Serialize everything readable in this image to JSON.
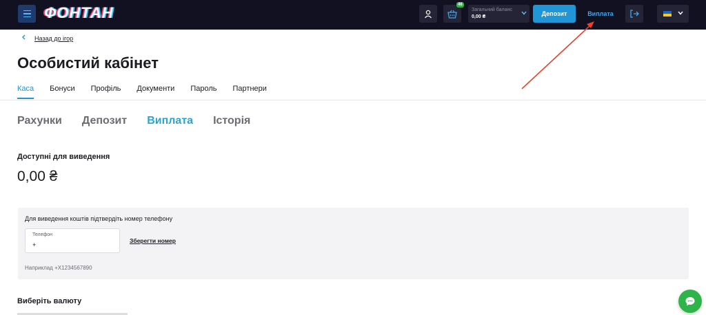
{
  "header": {
    "logo_text": "ФОНТАН",
    "cart_badge": "46",
    "balance_label": "Загальний баланс",
    "balance_value": "0,00 ₴",
    "deposit_label": "Депозит",
    "payout_label": "Виплата",
    "language_flag": "Ukraine",
    "icons": [
      "menu-icon",
      "user-icon",
      "basket-icon",
      "chevron-down-icon",
      "logout-icon",
      "flag-icon"
    ]
  },
  "back_link": "Назад до ігор",
  "page_title": "Особистий кабінет",
  "tabs": [
    {
      "label": "Каса"
    },
    {
      "label": "Бонуси"
    },
    {
      "label": "Профіль"
    },
    {
      "label": "Документи"
    },
    {
      "label": "Пароль"
    },
    {
      "label": "Партнери"
    }
  ],
  "subtabs": [
    {
      "label": "Рахунки"
    },
    {
      "label": "Депозит"
    },
    {
      "label": "Виплата"
    },
    {
      "label": "Історія"
    }
  ],
  "available": {
    "label": "Доступні для виведення",
    "amount": "0,00 ₴"
  },
  "phone_panel": {
    "message": "Для виведення коштів підтвердіть номер телефону",
    "field_label": "Телефон",
    "field_value": "+",
    "save_label": "Зберегти номер",
    "example": "Наприклад +X1234567890"
  },
  "currency_title": "Виберіть валюту",
  "colors": {
    "topbar": "#111122",
    "accent": "#2196d6",
    "active_subtab": "#2aa3d6",
    "chat": "#2fb44a",
    "annotation_arrow": "#e8412c"
  }
}
